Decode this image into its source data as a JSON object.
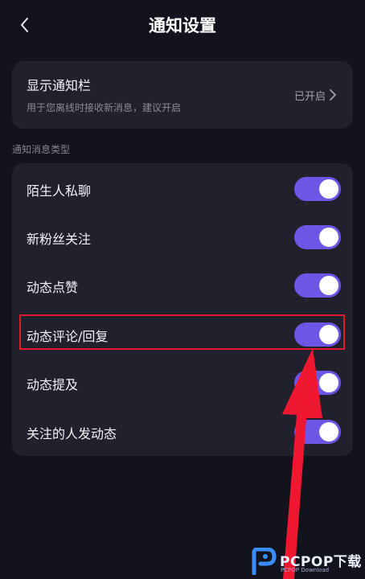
{
  "header": {
    "title": "通知设置",
    "back_icon": "chevron-left-icon"
  },
  "display_bar": {
    "label": "显示通知栏",
    "description": "用于您离线时接收新消息，建议开启",
    "status": "已开启",
    "chevron_icon": "chevron-right-icon"
  },
  "section_label": "通知消息类型",
  "toggles": [
    {
      "label": "陌生人私聊",
      "on": true
    },
    {
      "label": "新粉丝关注",
      "on": true
    },
    {
      "label": "动态点赞",
      "on": true
    },
    {
      "label": "动态评论/回复",
      "on": true,
      "highlighted": true
    },
    {
      "label": "动态提及",
      "on": true
    },
    {
      "label": "关注的人发动态",
      "on": true
    }
  ],
  "colors": {
    "background": "#13131d",
    "card": "#21212d",
    "toggle_on": "#6d55e6",
    "highlight": "#e01a2c",
    "arrow": "#f01830"
  },
  "watermark": {
    "text": "PCPOP下载",
    "sub": "PCPOP Download",
    "icon": "pcpop-logo-icon"
  }
}
